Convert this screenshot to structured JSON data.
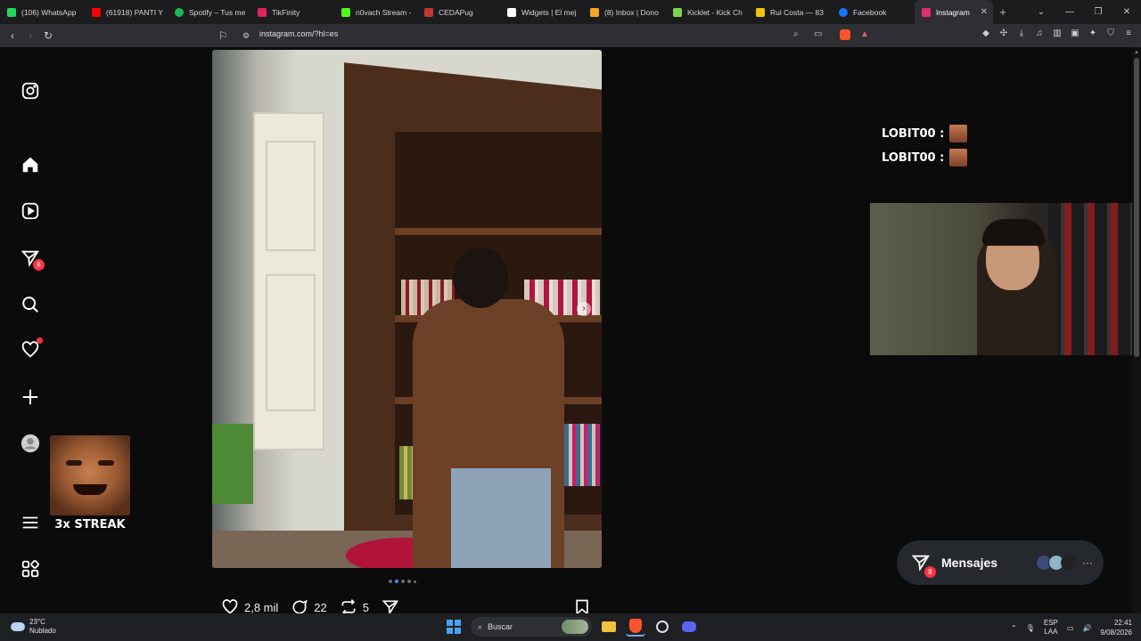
{
  "browser": {
    "tabs": [
      {
        "label": "(106) WhatsApp",
        "color": "#25d366"
      },
      {
        "label": "(61918) PANTI Y",
        "color": "#ff0000"
      },
      {
        "label": "Spotify – Tus me",
        "color": "#1db954"
      },
      {
        "label": "TikFinity",
        "color": "#e0245e"
      },
      {
        "label": "n0vach Stream -",
        "color": "#53fc18"
      },
      {
        "label": "CEDAPug",
        "color": "#c0392b"
      },
      {
        "label": "Widgets | El mej",
        "color": "#ffffff"
      },
      {
        "label": "(8) Inbox | Dono",
        "color": "#f6a623"
      },
      {
        "label": "Kicklet - Kick Ch",
        "color": "#7fd34e"
      },
      {
        "label": "Rui Costa — 83",
        "color": "#f1c40f"
      },
      {
        "label": "Facebook",
        "color": "#1877f2"
      },
      {
        "label": "Instagram",
        "color": "#e1306c"
      }
    ],
    "active_tab": "Instagram",
    "url": "instagram.com/?hl=es"
  },
  "sidebar": {
    "notifications_badge": "8"
  },
  "streak": {
    "label": "3x STREAK"
  },
  "post": {
    "likes": "2,8 mil",
    "comments": "22",
    "reposts": "5"
  },
  "chat": {
    "lines": [
      {
        "user": "LOBIT00 :"
      },
      {
        "user": "LOBIT00 :"
      }
    ]
  },
  "messages": {
    "label": "Mensajes",
    "badge": "8"
  },
  "taskbar": {
    "weather_temp": "23°C",
    "weather_desc": "Nublado",
    "search_label": "Buscar",
    "lang_top": "ESP",
    "lang_bottom": "LAA",
    "time": "22:41",
    "date": "9/08/2026"
  }
}
